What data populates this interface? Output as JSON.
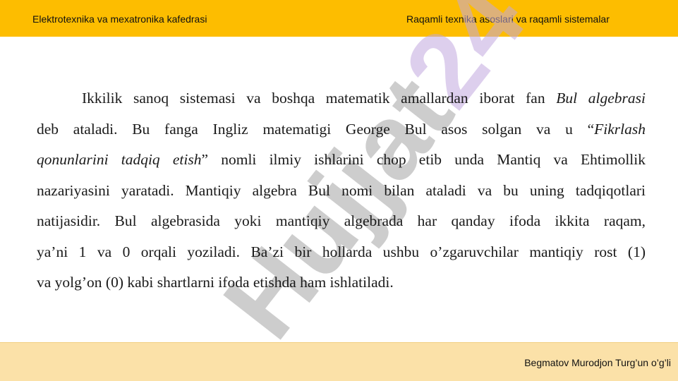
{
  "header": {
    "left_text": "Elektrotexnika va mexatronika kafedrasi",
    "right_text": "Raqamli texnika asoslari va raqamli sistemalar"
  },
  "watermark": {
    "text": "Hujjat24",
    "color": "#c3a8df",
    "gray_color": "#a6a6a6"
  },
  "content": {
    "lines": [
      {
        "parts": [
          "Ikkilik sanoq sistemasi va boshqa matematik amallardan iborat fan ",
          "Bul algebrasi"
        ]
      },
      {
        "parts": [
          "deb ataladi. Bu fanga Ingliz matematigi George Bul asos solgan va u “",
          "Fikrlash"
        ]
      },
      {
        "parts": [
          "qonunlarini tadqiq etish",
          "” nomli ilmiy ishlarini chop etib unda Mantiq va Ehtimollik"
        ]
      },
      {
        "parts": [
          "nazariyasini yaratadi. Mantiqiy algebra Bul nomi bilan ataladi va bu uning tadqiqotlari"
        ]
      },
      {
        "parts": [
          "natijasidir. Bul algebrasida yoki mantiqiy algebrada har qanday ifoda ikkita raqam,"
        ]
      },
      {
        "parts": [
          "ya’ni 1 va 0 orqali yoziladi. Ba’zi bir hollarda ushbu o’zgaruvchilar mantiqiy rost (1)"
        ]
      },
      {
        "parts": [
          "va yolg’on (0) kabi shartlarni ifoda etishda ham ishlatiladi."
        ]
      }
    ]
  },
  "footer": {
    "author": "Begmatov Murodjon Turg’un o’g’li"
  }
}
